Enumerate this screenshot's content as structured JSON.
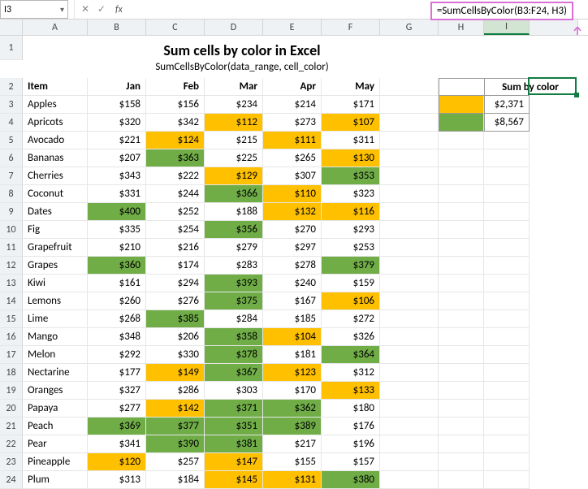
{
  "nameBox": "I3",
  "fxLabel": "fx",
  "formula": "=SumCellsByColor(B3:F24, H3)",
  "title1": "Sum cells by color in Excel",
  "title2": "SumCellsByColor(data_range, cell_color)",
  "cols": [
    "",
    "A",
    "B",
    "C",
    "D",
    "E",
    "F",
    "G",
    "H",
    "I",
    ""
  ],
  "rowLabels": [
    "1",
    "2",
    "3",
    "4",
    "5",
    "6",
    "7",
    "8",
    "9",
    "10",
    "11",
    "12",
    "13",
    "14",
    "15",
    "16",
    "17",
    "18",
    "19",
    "20",
    "21",
    "22",
    "23",
    "24"
  ],
  "headers": [
    "Item",
    "Jan",
    "Feb",
    "Mar",
    "Apr",
    "May"
  ],
  "sumHeader": "Sum by color",
  "sumRows": [
    {
      "swatch": "amber",
      "value": "$2,371"
    },
    {
      "swatch": "green",
      "value": "$8,567"
    }
  ],
  "data": [
    {
      "item": "Apples",
      "v": [
        {
          "t": "$158"
        },
        {
          "t": "$156"
        },
        {
          "t": "$234"
        },
        {
          "t": "$214"
        },
        {
          "t": "$171"
        }
      ]
    },
    {
      "item": "Apricots",
      "v": [
        {
          "t": "$320"
        },
        {
          "t": "$342"
        },
        {
          "t": "$112",
          "c": "amber"
        },
        {
          "t": "$273"
        },
        {
          "t": "$107",
          "c": "amber"
        }
      ]
    },
    {
      "item": "Avocado",
      "v": [
        {
          "t": "$221"
        },
        {
          "t": "$124",
          "c": "amber"
        },
        {
          "t": "$215"
        },
        {
          "t": "$111",
          "c": "amber"
        },
        {
          "t": "$311"
        }
      ]
    },
    {
      "item": "Bananas",
      "v": [
        {
          "t": "$207"
        },
        {
          "t": "$363",
          "c": "green"
        },
        {
          "t": "$225"
        },
        {
          "t": "$265"
        },
        {
          "t": "$130",
          "c": "amber"
        }
      ]
    },
    {
      "item": "Cherries",
      "v": [
        {
          "t": "$343"
        },
        {
          "t": "$222"
        },
        {
          "t": "$129",
          "c": "amber"
        },
        {
          "t": "$307"
        },
        {
          "t": "$353",
          "c": "green"
        }
      ]
    },
    {
      "item": "Coconut",
      "v": [
        {
          "t": "$331"
        },
        {
          "t": "$244"
        },
        {
          "t": "$366",
          "c": "green"
        },
        {
          "t": "$110",
          "c": "amber"
        },
        {
          "t": "$323"
        }
      ]
    },
    {
      "item": "Dates",
      "v": [
        {
          "t": "$400",
          "c": "green"
        },
        {
          "t": "$252"
        },
        {
          "t": "$188"
        },
        {
          "t": "$132",
          "c": "amber"
        },
        {
          "t": "$116",
          "c": "amber"
        }
      ]
    },
    {
      "item": "Fig",
      "v": [
        {
          "t": "$335"
        },
        {
          "t": "$254"
        },
        {
          "t": "$356",
          "c": "green"
        },
        {
          "t": "$270"
        },
        {
          "t": "$293"
        }
      ]
    },
    {
      "item": "Grapefruit",
      "v": [
        {
          "t": "$210"
        },
        {
          "t": "$216"
        },
        {
          "t": "$279"
        },
        {
          "t": "$297"
        },
        {
          "t": "$253"
        }
      ]
    },
    {
      "item": "Grapes",
      "v": [
        {
          "t": "$360",
          "c": "green"
        },
        {
          "t": "$174"
        },
        {
          "t": "$283"
        },
        {
          "t": "$278"
        },
        {
          "t": "$379",
          "c": "green"
        }
      ]
    },
    {
      "item": "Kiwi",
      "v": [
        {
          "t": "$161"
        },
        {
          "t": "$294"
        },
        {
          "t": "$393",
          "c": "green"
        },
        {
          "t": "$240"
        },
        {
          "t": "$159"
        }
      ]
    },
    {
      "item": "Lemons",
      "v": [
        {
          "t": "$260"
        },
        {
          "t": "$276"
        },
        {
          "t": "$375",
          "c": "green"
        },
        {
          "t": "$167"
        },
        {
          "t": "$106",
          "c": "amber"
        }
      ]
    },
    {
      "item": "Lime",
      "v": [
        {
          "t": "$268"
        },
        {
          "t": "$385",
          "c": "green"
        },
        {
          "t": "$284"
        },
        {
          "t": "$185"
        },
        {
          "t": "$272"
        }
      ]
    },
    {
      "item": "Mango",
      "v": [
        {
          "t": "$348"
        },
        {
          "t": "$206"
        },
        {
          "t": "$358",
          "c": "green"
        },
        {
          "t": "$104",
          "c": "amber"
        },
        {
          "t": "$326"
        }
      ]
    },
    {
      "item": "Melon",
      "v": [
        {
          "t": "$292"
        },
        {
          "t": "$330"
        },
        {
          "t": "$378",
          "c": "green"
        },
        {
          "t": "$181"
        },
        {
          "t": "$364",
          "c": "green"
        }
      ]
    },
    {
      "item": "Nectarine",
      "v": [
        {
          "t": "$177"
        },
        {
          "t": "$149",
          "c": "amber"
        },
        {
          "t": "$367",
          "c": "green"
        },
        {
          "t": "$123",
          "c": "amber"
        },
        {
          "t": "$312"
        }
      ]
    },
    {
      "item": "Oranges",
      "v": [
        {
          "t": "$327"
        },
        {
          "t": "$286"
        },
        {
          "t": "$303"
        },
        {
          "t": "$170"
        },
        {
          "t": "$133",
          "c": "amber"
        }
      ]
    },
    {
      "item": "Papaya",
      "v": [
        {
          "t": "$277"
        },
        {
          "t": "$142",
          "c": "amber"
        },
        {
          "t": "$371",
          "c": "green"
        },
        {
          "t": "$362",
          "c": "green"
        },
        {
          "t": "$180"
        }
      ]
    },
    {
      "item": "Peach",
      "v": [
        {
          "t": "$369",
          "c": "green"
        },
        {
          "t": "$377",
          "c": "green"
        },
        {
          "t": "$351",
          "c": "green"
        },
        {
          "t": "$389",
          "c": "green"
        },
        {
          "t": "$176"
        }
      ]
    },
    {
      "item": "Pear",
      "v": [
        {
          "t": "$341"
        },
        {
          "t": "$390",
          "c": "green"
        },
        {
          "t": "$381",
          "c": "green"
        },
        {
          "t": "$217"
        },
        {
          "t": "$196"
        }
      ]
    },
    {
      "item": "Pineapple",
      "v": [
        {
          "t": "$120",
          "c": "amber"
        },
        {
          "t": "$257"
        },
        {
          "t": "$147",
          "c": "amber"
        },
        {
          "t": "$155"
        },
        {
          "t": "$157"
        }
      ]
    },
    {
      "item": "Plum",
      "v": [
        {
          "t": "$313"
        },
        {
          "t": "$184"
        },
        {
          "t": "$145",
          "c": "amber"
        },
        {
          "t": "$131",
          "c": "amber"
        },
        {
          "t": "$380",
          "c": "green"
        }
      ]
    }
  ]
}
